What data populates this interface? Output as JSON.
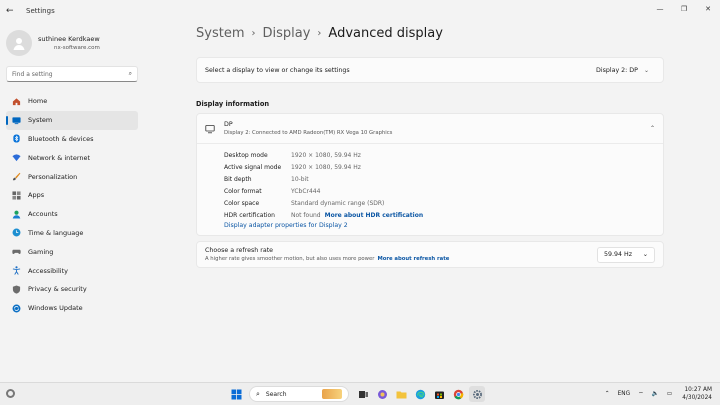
{
  "window": {
    "title": "Settings"
  },
  "profile": {
    "name": "suthinee Kerdkaew",
    "email_suffix": "nx-software.com"
  },
  "search": {
    "placeholder": "Find a setting"
  },
  "nav": [
    {
      "label": "Home",
      "icon": "home-icon",
      "color": "#c2502d"
    },
    {
      "label": "System",
      "icon": "system-icon",
      "color": "#0067c0"
    },
    {
      "label": "Bluetooth & devices",
      "icon": "bluetooth-icon",
      "color": "#0a74da"
    },
    {
      "label": "Network & internet",
      "icon": "network-icon",
      "color": "#2b6cd8"
    },
    {
      "label": "Personalization",
      "icon": "brush-icon",
      "color": "#e08a1e"
    },
    {
      "label": "Apps",
      "icon": "apps-icon",
      "color": "#555555"
    },
    {
      "label": "Accounts",
      "icon": "accounts-icon",
      "color": "#1aa260"
    },
    {
      "label": "Time & language",
      "icon": "time-icon",
      "color": "#1d8fd1"
    },
    {
      "label": "Gaming",
      "icon": "gaming-icon",
      "color": "#6b6b6b"
    },
    {
      "label": "Accessibility",
      "icon": "accessibility-icon",
      "color": "#1d6fc5"
    },
    {
      "label": "Privacy & security",
      "icon": "shield-icon",
      "color": "#6c6c6c"
    },
    {
      "label": "Windows Update",
      "icon": "update-icon",
      "color": "#0b6fc4"
    }
  ],
  "breadcrumb": [
    "System",
    "Display",
    "Advanced display"
  ],
  "display_select": {
    "label": "Select a display to view or change its settings",
    "value": "Display 2: DP"
  },
  "section": {
    "title": "Display information"
  },
  "info": {
    "title": "DP",
    "subtitle": "Display 2: Connected to AMD Radeon(TM) RX Vega 10 Graphics",
    "rows": [
      {
        "key": "Desktop mode",
        "value": "1920 × 1080, 59.94 Hz"
      },
      {
        "key": "Active signal mode",
        "value": "1920 × 1080, 59.94 Hz"
      },
      {
        "key": "Bit depth",
        "value": "10-bit"
      },
      {
        "key": "Color format",
        "value": "YCbCr444"
      },
      {
        "key": "Color space",
        "value": "Standard dynamic range (SDR)"
      },
      {
        "key": "HDR certification",
        "value": "Not found",
        "link": "More about HDR certification"
      }
    ],
    "adapter_link": "Display adapter properties for Display 2"
  },
  "refresh": {
    "title": "Choose a refresh rate",
    "subtitle": "A higher rate gives smoother motion, but also uses more power",
    "link": "More about refresh rate",
    "value": "59.94 Hz"
  },
  "taskbar": {
    "search_label": "Search",
    "language": "ENG",
    "time": "10:27 AM",
    "date": "4/30/2024"
  },
  "colors": {
    "accent": "#0067c0",
    "link": "#0b56a4"
  }
}
